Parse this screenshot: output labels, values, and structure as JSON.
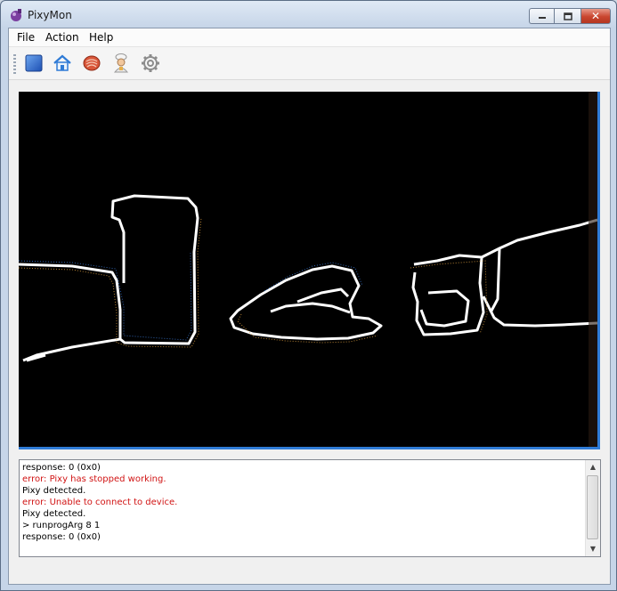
{
  "window": {
    "title": "PixyMon"
  },
  "menu": [
    {
      "label": "File"
    },
    {
      "label": "Action"
    },
    {
      "label": "Help"
    }
  ],
  "toolbar": {
    "tools": [
      {
        "icon": "stop-icon"
      },
      {
        "icon": "home-icon"
      },
      {
        "icon": "cooked-video-icon"
      },
      {
        "icon": "chef-icon"
      },
      {
        "icon": "gear-icon"
      }
    ]
  },
  "console": {
    "lines": [
      {
        "text": "response: 0 (0x0)",
        "kind": "normal"
      },
      {
        "text": "error: Pixy has stopped working.",
        "kind": "error"
      },
      {
        "text": "Pixy detected.",
        "kind": "normal"
      },
      {
        "text": "error: Unable to connect to device.",
        "kind": "error"
      },
      {
        "text": "Pixy detected.",
        "kind": "normal"
      },
      {
        "text": "> runprogArg 8 1",
        "kind": "normal"
      },
      {
        "text": "response: 0 (0x0)",
        "kind": "normal"
      }
    ]
  },
  "colors": {
    "error": "#d11414",
    "normal": "#000000",
    "accent": "#2f7bd6"
  }
}
